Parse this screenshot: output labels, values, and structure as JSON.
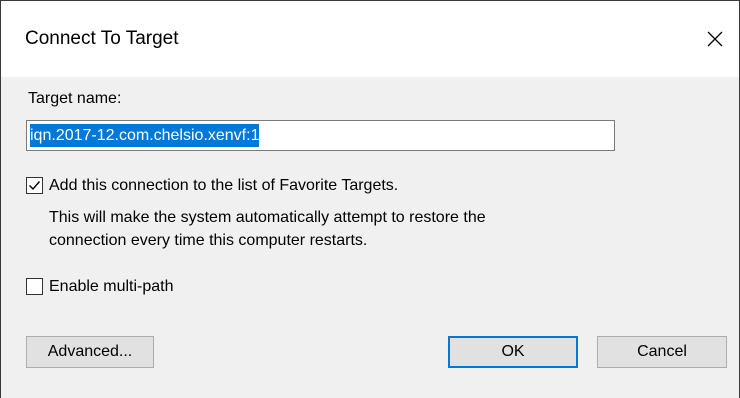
{
  "window": {
    "title": "Connect To Target",
    "close_icon": "close-icon"
  },
  "target": {
    "label": "Target name:",
    "value": "iqn.2017-12.com.chelsio.xenvf:1"
  },
  "favorite": {
    "checked": true,
    "label": "Add this connection to the list of Favorite Targets.",
    "description_line1": "This will make the system automatically attempt to restore the",
    "description_line2": "connection every time this computer restarts."
  },
  "multipath": {
    "checked": false,
    "label": "Enable multi-path"
  },
  "buttons": {
    "advanced": "Advanced...",
    "ok": "OK",
    "cancel": "Cancel"
  },
  "colors": {
    "accent": "#0078d7",
    "dialog_background": "#f0f0f0",
    "title_background": "#ffffff"
  }
}
